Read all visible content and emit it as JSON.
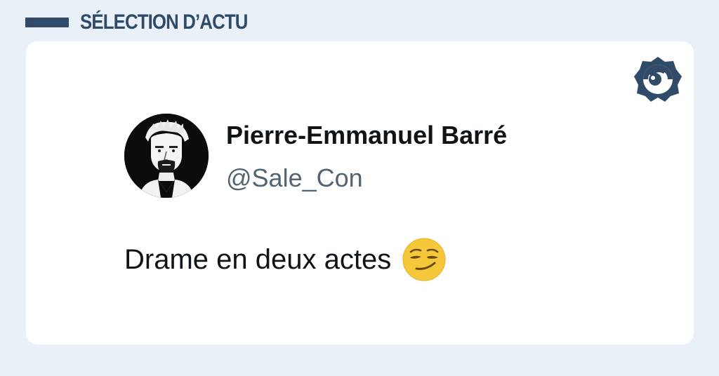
{
  "header": {
    "title": "SÉLECTION D’ACTU"
  },
  "tweet": {
    "author_name": "Pierre-Emmanuel Barré",
    "author_handle": "@Sale_Con",
    "text": "Drame en deux actes",
    "emoji": "smirking-face-emoji"
  },
  "icons": {
    "brand_logo": "brand-logo-icon"
  },
  "colors": {
    "background": "#eaf0f7",
    "accent": "#2f4b67",
    "card": "#ffffff",
    "name_text": "#0f1419",
    "handle_text": "#536471",
    "emoji_yellow": "#f5c73b"
  }
}
